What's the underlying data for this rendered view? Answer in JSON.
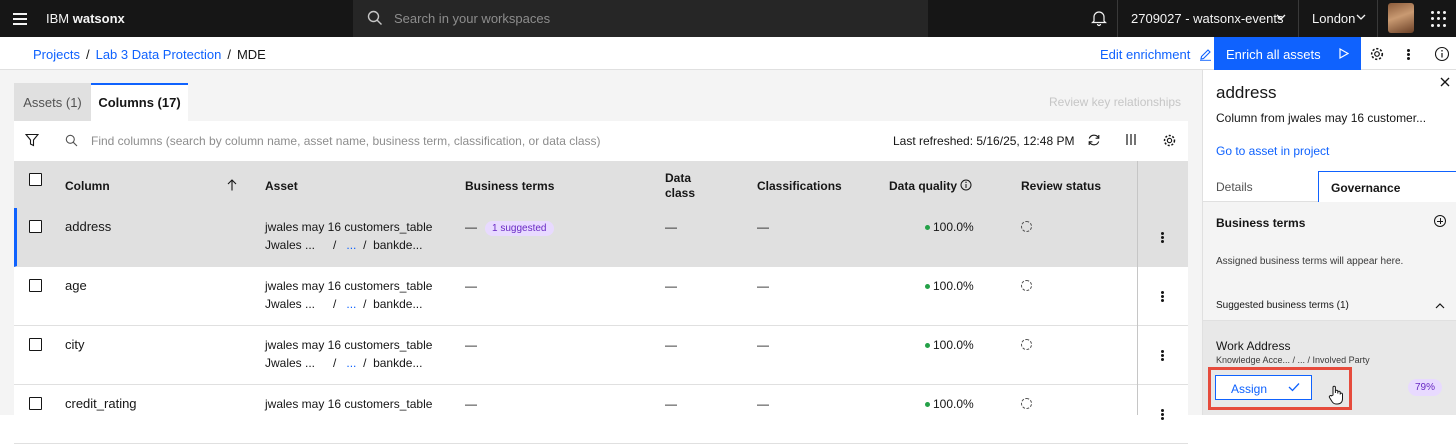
{
  "topbar": {
    "brand_prefix": "IBM",
    "brand_name": "watsonx",
    "search_placeholder": "Search in your workspaces",
    "account": "2709027 - watsonx-events",
    "region": "London"
  },
  "breadcrumb": {
    "items": [
      "Projects",
      "Lab 3 Data Protection"
    ],
    "current": "MDE"
  },
  "actions": {
    "edit_enrichment": "Edit enrichment",
    "enrich_all": "Enrich all assets"
  },
  "tabs": {
    "assets": "Assets (1)",
    "columns": "Columns (17)"
  },
  "review_key_relationships": "Review key relationships",
  "table_toolbar": {
    "search_placeholder": "Find columns (search by column name, asset name, business term, classification, or data class)",
    "last_refreshed": "Last refreshed: 5/16/25, 12:48 PM"
  },
  "table": {
    "headers": {
      "column": "Column",
      "asset": "Asset",
      "business_terms": "Business terms",
      "data_class_1": "Data",
      "data_class_2": "class",
      "classifications": "Classifications",
      "data_quality": "Data quality",
      "review_status": "Review status"
    },
    "rows": [
      {
        "name": "address",
        "asset": "jwales may 16 customers_table",
        "path1": "Jwales ...",
        "path_sep": "/",
        "path_ellipsis": "...",
        "path3": "bankde...",
        "terms_dash": "—",
        "terms_badge": "1 suggested",
        "data_class": "—",
        "classifications": "—",
        "quality": "100.0%"
      },
      {
        "name": "age",
        "asset": "jwales may 16 customers_table",
        "path1": "Jwales ...",
        "path_sep": "/",
        "path_ellipsis": "...",
        "path3": "bankde...",
        "terms_dash": "—",
        "data_class": "—",
        "classifications": "—",
        "quality": "100.0%"
      },
      {
        "name": "city",
        "asset": "jwales may 16 customers_table",
        "path1": "Jwales ...",
        "path_sep": "/",
        "path_ellipsis": "...",
        "path3": "bankde...",
        "terms_dash": "—",
        "data_class": "—",
        "classifications": "—",
        "quality": "100.0%"
      },
      {
        "name": "credit_rating",
        "asset": "jwales may 16 customers_table",
        "terms_dash": "—",
        "data_class": "—",
        "classifications": "—",
        "quality": "100.0%"
      }
    ]
  },
  "panel": {
    "title": "address",
    "subtitle": "Column from jwales may 16 customer...",
    "go_to_asset": "Go to asset in project",
    "tab_details": "Details",
    "tab_governance": "Governance",
    "business_terms_heading": "Business terms",
    "empty_message": "Assigned business terms will appear here.",
    "suggested_heading": "Suggested business terms (1)",
    "suggestion": {
      "term": "Work Address",
      "path": "Knowledge Acce...  /  ...  /  Involved Party",
      "assign_label": "Assign",
      "confidence": "79%"
    }
  },
  "colors": {
    "topbar_bg": "#161616",
    "primary": "#0f62fe",
    "badge_bg": "#e8daff",
    "badge_fg": "#6929c4",
    "quality_ok": "#24a148",
    "highlight": "#e64b3c"
  }
}
